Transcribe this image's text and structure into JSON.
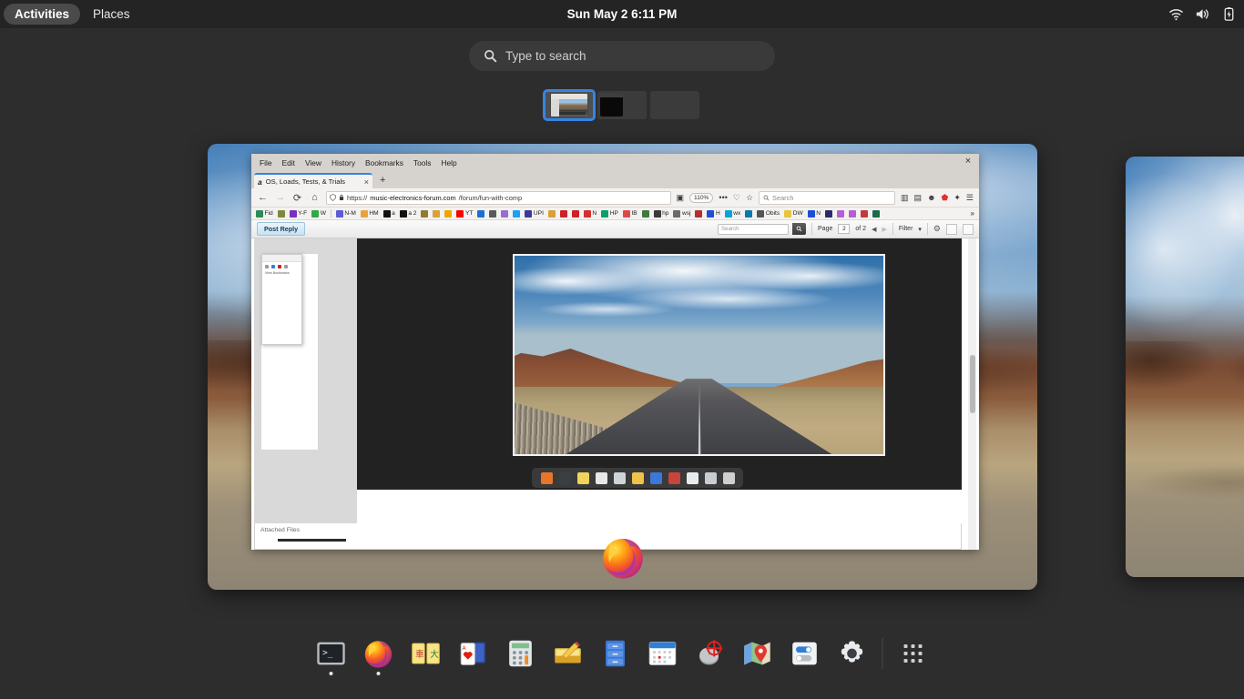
{
  "topbar": {
    "activities_label": "Activities",
    "places_label": "Places",
    "clock": "Sun May 2  6:11 PM",
    "indicators": [
      "wifi-icon",
      "volume-icon",
      "battery-charging-icon"
    ]
  },
  "search": {
    "placeholder": "Type to search",
    "icon": "search-icon"
  },
  "workspaces": {
    "count": 3,
    "selected_index": 0,
    "selected_accent": "#3584e4",
    "items": [
      {
        "label": "Workspace 1",
        "state": "selected"
      },
      {
        "label": "Workspace 2",
        "state": "occupied"
      },
      {
        "label": "Workspace 3",
        "state": "empty"
      }
    ]
  },
  "windows": [
    {
      "name": "firefox-window",
      "app": "Firefox"
    },
    {
      "name": "secondary-window",
      "app": "Wallpaper window"
    }
  ],
  "browser": {
    "menu": [
      "File",
      "Edit",
      "View",
      "History",
      "Bookmarks",
      "Tools",
      "Help"
    ],
    "tab": {
      "favicon": "a",
      "title": "OS, Loads, Tests, & Trials",
      "close": "×"
    },
    "new_tab": "+",
    "nav": {
      "back": "←",
      "forward": "→",
      "reload": "⟳",
      "home": "⌂"
    },
    "url": {
      "shield_icon": "tracking-protection-icon",
      "lock_icon": "lock-icon",
      "prefix": "https://",
      "host": "music-electronics-forum.com",
      "path": "/forum/fun-with-comp",
      "reader_icon": "reader-mode-icon",
      "zoom": "110%",
      "ellipsis": "•••",
      "pocket_icon": "pocket-icon",
      "bookmark_icon": "star-icon"
    },
    "search_placeholder": "Search",
    "toolbar_icons": [
      "library-icon",
      "sidebar-icon",
      "account-icon",
      "shield-icon",
      "extension-icon",
      "menu-icon"
    ],
    "bookmarks": [
      {
        "label": "Fid",
        "color": "#2e8b57"
      },
      {
        "label": "",
        "color": "#7a8b3a"
      },
      {
        "label": "Y-F",
        "color": "#7b2fbe"
      },
      {
        "label": "W",
        "color": "#2faa4a"
      },
      {
        "label": "N-M",
        "color": "#5b5bd6"
      },
      {
        "label": "HM",
        "color": "#e8a33d"
      },
      {
        "label": "a",
        "color": "#111111"
      },
      {
        "label": "a 2",
        "color": "#111111"
      },
      {
        "label": "",
        "color": "#8f7a2e"
      },
      {
        "label": "",
        "color": "#d8a23b"
      },
      {
        "label": "",
        "color": "#f0a500"
      },
      {
        "label": "YT",
        "color": "#ff0000"
      },
      {
        "label": "",
        "color": "#1c6fd4"
      },
      {
        "label": "",
        "color": "#5a5a5a"
      },
      {
        "label": "",
        "color": "#9a6ccf"
      },
      {
        "label": "",
        "color": "#1da1f2"
      },
      {
        "label": "UPI",
        "color": "#3a3a9a"
      },
      {
        "label": "",
        "color": "#d6a13a"
      },
      {
        "label": "",
        "color": "#cc2127"
      },
      {
        "label": "",
        "color": "#cc2127"
      },
      {
        "label": "N",
        "color": "#d32f2f"
      },
      {
        "label": "HP",
        "color": "#0aa06e"
      },
      {
        "label": "IB",
        "color": "#d94b4b"
      },
      {
        "label": "",
        "color": "#3e7a3e"
      },
      {
        "label": "hp",
        "color": "#3a3a3a"
      },
      {
        "label": "wsj",
        "color": "#6b6b6b"
      },
      {
        "label": "",
        "color": "#b03030"
      },
      {
        "label": "H",
        "color": "#1a4fd6"
      },
      {
        "label": "wx",
        "color": "#0aa3d6"
      },
      {
        "label": "",
        "color": "#0b7aa8"
      },
      {
        "label": "Obits",
        "color": "#555555"
      },
      {
        "label": "DW",
        "color": "#e8c33d"
      },
      {
        "label": "N",
        "color": "#1a4fd6"
      },
      {
        "label": "",
        "color": "#2a2a6a"
      },
      {
        "label": "",
        "color": "#b35fd6"
      },
      {
        "label": "",
        "color": "#b35fd6"
      },
      {
        "label": "",
        "color": "#c43a3a"
      },
      {
        "label": "",
        "color": "#1a6b4a"
      }
    ],
    "bookmarks_overflow": "»"
  },
  "forum": {
    "post_reply_button": "Post Reply",
    "search_placeholder": "Search",
    "search_button_icon": "search-icon",
    "page_label": "Page",
    "page_value": "2",
    "page_of": "of 2",
    "prev_arrow": "◀",
    "next_arrow": "▶",
    "filter_label": "Filter",
    "filter_caret": "▾",
    "gear_icon": "settings-gear-icon",
    "image_icon": "image-tool-icon",
    "checkbox_icon": "empty-checkbox-icon",
    "attached_files_label": "Attached Files",
    "photo_alt": "mountain road landscape photo"
  },
  "mini_dock": {
    "items": [
      "firefox-icon",
      "terminal-icon",
      "mahjongg-icon",
      "solitaire-icon",
      "calculator-icon",
      "notes-icon",
      "archive-icon",
      "mouse-icon",
      "maps-icon",
      "settings-icon",
      "app-grid-icon"
    ]
  },
  "dock": {
    "items": [
      {
        "name": "terminal",
        "label": "Terminal",
        "running": true
      },
      {
        "name": "firefox",
        "label": "Firefox",
        "running": true
      },
      {
        "name": "mahjongg",
        "label": "Mahjongg",
        "running": false
      },
      {
        "name": "solitaire",
        "label": "AisleRiot Solitaire",
        "running": false
      },
      {
        "name": "calculator",
        "label": "Calculator",
        "running": false
      },
      {
        "name": "text-editor",
        "label": "Text Editor",
        "running": false
      },
      {
        "name": "archive",
        "label": "File Roller",
        "running": false
      },
      {
        "name": "calendar",
        "label": "Calendar",
        "running": false
      },
      {
        "name": "mouse-target",
        "label": "Mouse Settings",
        "running": false
      },
      {
        "name": "maps",
        "label": "Maps",
        "running": false
      },
      {
        "name": "tweaks",
        "label": "Tweaks",
        "running": false
      },
      {
        "name": "settings",
        "label": "Settings",
        "running": false
      }
    ],
    "show_apps_label": "Show Applications"
  },
  "colors": {
    "overview_bg": "#2d2d2d",
    "topbar_bg": "#242424",
    "accent": "#3584e4",
    "dock_bg": "rgba(46,46,46,.92)"
  }
}
